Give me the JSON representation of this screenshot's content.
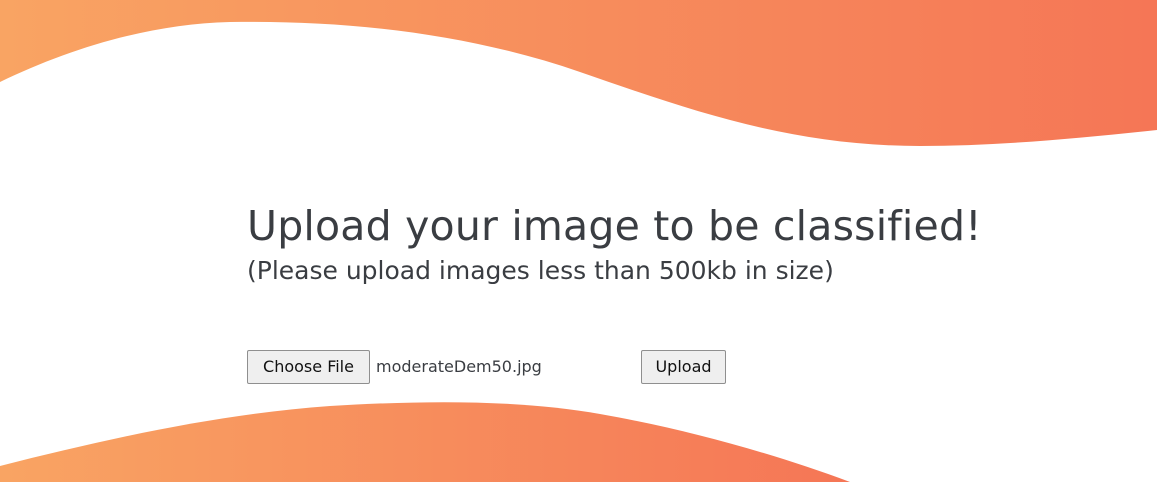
{
  "colors": {
    "wave_gradient_start": "#f9a463",
    "wave_gradient_end": "#f57656",
    "text": "#3a3d42"
  },
  "heading": {
    "title": "Upload your image to be classified!",
    "subtitle": "(Please upload images less than 500kb in size)"
  },
  "form": {
    "choose_file_label": "Choose File",
    "selected_file": "moderateDem50.jpg",
    "upload_label": "Upload"
  }
}
